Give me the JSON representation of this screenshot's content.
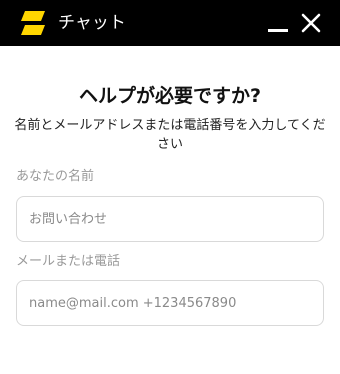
{
  "header": {
    "title": "チャット",
    "logo_icon": "brand-logo-icon",
    "minimize_icon": "minimize-icon",
    "close_icon": "close-icon",
    "background_color": "#000000",
    "logo_color": "#ffd600"
  },
  "main": {
    "heading": "ヘルプが必要ですか?",
    "subtitle": "名前とメールアドレスまたは電話番号を入力してください",
    "name_field": {
      "label": "あなたの名前",
      "placeholder": "お問い合わせ",
      "value": ""
    },
    "contact_field": {
      "label": "メールまたは電話",
      "placeholder": "name@mail.com +1234567890",
      "value": ""
    }
  }
}
